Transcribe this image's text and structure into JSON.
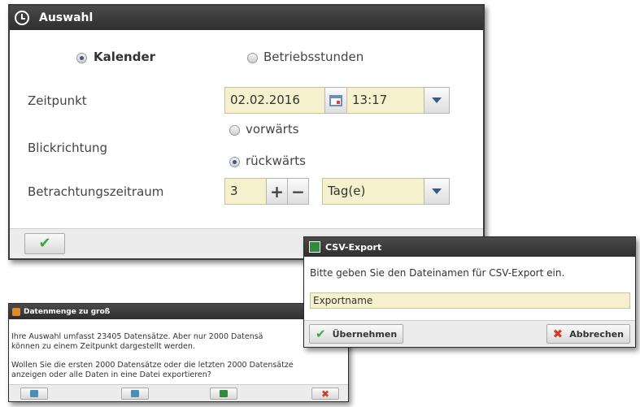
{
  "main_dialog": {
    "title": "Auswahl",
    "mode_kalender": "Kalender",
    "mode_betriebsstunden": "Betriebsstunden",
    "zeitpunkt_label": "Zeitpunkt",
    "date_value": "02.02.2016",
    "time_value": "13:17",
    "blickrichtung_label": "Blickrichtung",
    "dir_forward": "vorwärts",
    "dir_backward": "rückwärts",
    "zeitraum_label": "Betrachtungszeitraum",
    "zeitraum_value": "3",
    "plus": "+",
    "minus": "−",
    "unit_value": "Tag(e)"
  },
  "csv_dialog": {
    "title": "CSV-Export",
    "prompt": "Bitte geben Sie den Dateinamen für CSV-Export ein.",
    "filename_value": "Exportname",
    "apply_label": "Übernehmen",
    "cancel_label": "Abbrechen"
  },
  "data_dialog": {
    "title": "Datenmenge zu groß",
    "line1": "Ihre Auswahl umfasst 23405 Datensätze. Aber nur 2000 Datensä",
    "line2": "können zu einem Zeitpunkt dargestellt werden.",
    "line3": "Wollen Sie die ersten 2000 Datensätze oder die letzten 2000 Datensätze",
    "line4": "anzeigen oder alle Daten in eine Datei exportieren?"
  },
  "colors": {
    "titlebar": "#3a3a3a",
    "field_bg": "#f5f1cc",
    "ok_green": "#3ca83c",
    "cancel_red": "#d83a2a",
    "accent_blue": "#3d5b88"
  }
}
